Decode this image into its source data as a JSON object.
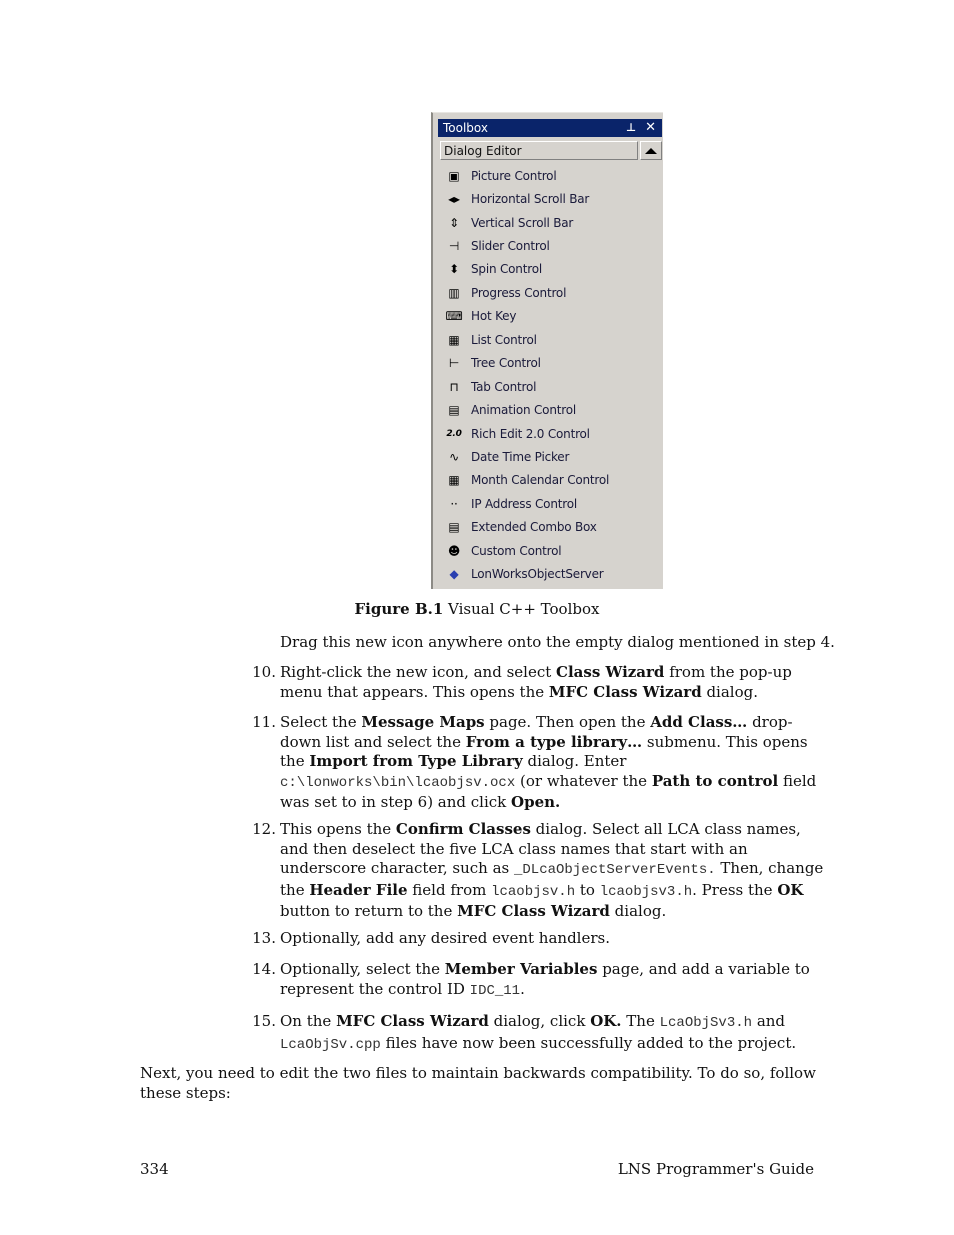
{
  "toolbox": {
    "title": "Toolbox",
    "pin_glyph": "⊥",
    "close_glyph": "✕",
    "section_label": "Dialog Editor",
    "items": [
      {
        "label": "Picture Control",
        "icon": "picture-control-icon",
        "glyph": "▣"
      },
      {
        "label": "Horizontal Scroll Bar",
        "icon": "horizontal-scroll-bar-icon",
        "glyph": "◂▸"
      },
      {
        "label": "Vertical Scroll Bar",
        "icon": "vertical-scroll-bar-icon",
        "glyph": "⇕"
      },
      {
        "label": "Slider Control",
        "icon": "slider-control-icon",
        "glyph": "⊣"
      },
      {
        "label": "Spin Control",
        "icon": "spin-control-icon",
        "glyph": "⬍"
      },
      {
        "label": "Progress Control",
        "icon": "progress-control-icon",
        "glyph": "▥"
      },
      {
        "label": "Hot Key",
        "icon": "hot-key-icon",
        "glyph": "⌨"
      },
      {
        "label": "List Control",
        "icon": "list-control-icon",
        "glyph": "▦"
      },
      {
        "label": "Tree Control",
        "icon": "tree-control-icon",
        "glyph": "⊢"
      },
      {
        "label": "Tab Control",
        "icon": "tab-control-icon",
        "glyph": "⊓"
      },
      {
        "label": "Animation Control",
        "icon": "animation-control-icon",
        "glyph": "▤"
      },
      {
        "label": "Rich Edit 2.0 Control",
        "icon": "rich-edit-icon",
        "glyph": "2.0"
      },
      {
        "label": "Date Time Picker",
        "icon": "date-time-picker-icon",
        "glyph": "∿"
      },
      {
        "label": "Month Calendar Control",
        "icon": "month-calendar-icon",
        "glyph": "▦"
      },
      {
        "label": "IP Address Control",
        "icon": "ip-address-icon",
        "glyph": "··"
      },
      {
        "label": "Extended Combo Box",
        "icon": "extended-combo-box-icon",
        "glyph": "▤"
      },
      {
        "label": "Custom Control",
        "icon": "custom-control-icon",
        "glyph": "☻"
      },
      {
        "label": "LonWorksObjectServer",
        "icon": "lonworks-object-server-icon",
        "glyph": "◆"
      }
    ]
  },
  "caption": {
    "bold": "Figure B.1",
    "text": " Visual C++ Toolbox"
  },
  "intro": "Drag this new icon anywhere onto the empty dialog mentioned in step 4.",
  "steps": [
    {
      "num": "10.",
      "parts": [
        {
          "t": "Right-click the new icon, and select "
        },
        {
          "b": "Class Wizard"
        },
        {
          "t": " from the pop-up menu that appears. This opens the "
        },
        {
          "b": "MFC Class Wizard"
        },
        {
          "t": " dialog."
        }
      ]
    },
    {
      "num": "11.",
      "parts": [
        {
          "t": "Select the "
        },
        {
          "b": "Message Maps"
        },
        {
          "t": " page. Then open the "
        },
        {
          "b": "Add Class…"
        },
        {
          "t": " drop-down list and select the "
        },
        {
          "b": "From a type library…"
        },
        {
          "t": " submenu. This opens the "
        },
        {
          "b": "Import from Type Library"
        },
        {
          "t": " dialog. Enter "
        },
        {
          "br": true
        },
        {
          "m": "c:\\lonworks\\bin\\lcaobjsv.ocx"
        },
        {
          "t": "  (or whatever the "
        },
        {
          "b": "Path to control"
        },
        {
          "t": " field was set to in step 6) and click "
        },
        {
          "b": "Open."
        }
      ]
    },
    {
      "num": "12.",
      "parts": [
        {
          "t": "This opens the "
        },
        {
          "b": "Confirm Classes"
        },
        {
          "t": " dialog. Select all LCA class names, and then deselect the five LCA class names that start with an underscore character, such as "
        },
        {
          "m": "_DLcaObjectServerEvents."
        },
        {
          "t": "  Then, change the "
        },
        {
          "b": "Header File"
        },
        {
          "t": " field from "
        },
        {
          "m": "lcaobjsv.h"
        },
        {
          "t": " to "
        },
        {
          "m": "lcaobjsv3.h"
        },
        {
          "t": ". Press the "
        },
        {
          "b": "OK"
        },
        {
          "t": " button to return to the "
        },
        {
          "b": "MFC Class Wizard"
        },
        {
          "t": " dialog."
        }
      ]
    },
    {
      "num": "13.",
      "parts": [
        {
          "t": "Optionally, add any desired event handlers."
        }
      ]
    },
    {
      "num": "14.",
      "parts": [
        {
          "t": "Optionally, select the "
        },
        {
          "b": "Member Variables"
        },
        {
          "t": " page, and add a variable to represent the control ID "
        },
        {
          "m": "IDC_11"
        },
        {
          "t": "."
        }
      ]
    },
    {
      "num": "15.",
      "parts": [
        {
          "t": "On the "
        },
        {
          "b": "MFC Class Wizard"
        },
        {
          "t": " dialog, click "
        },
        {
          "b": "OK."
        },
        {
          "t": " The "
        },
        {
          "m": "LcaObjSv3.h"
        },
        {
          "t": "  and "
        },
        {
          "m": "LcaObjSv.cpp"
        },
        {
          "t": " files have now been successfully added to the project."
        }
      ]
    }
  ],
  "closing": "Next, you need to edit the two files to maintain backwards compatibility. To do so, follow these steps:",
  "footer": {
    "page_number": "334",
    "book_title": "LNS Programmer's Guide"
  }
}
